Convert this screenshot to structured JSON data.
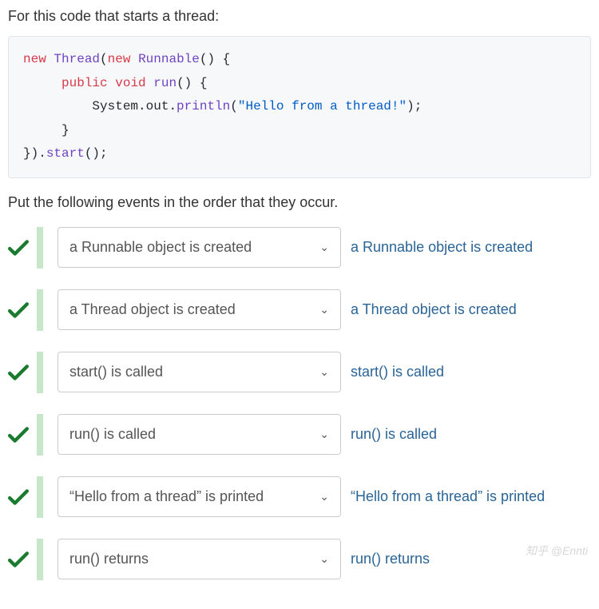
{
  "intro": "For this code that starts a thread:",
  "code": {
    "line1_new": "new",
    "line1_thread": "Thread",
    "line1_open": "(",
    "line1_new2": "new",
    "line1_runnable": "Runnable",
    "line1_tail": "() {",
    "line2_public": "public",
    "line2_void": "void",
    "line2_run": "run",
    "line2_tail": "() {",
    "line3_head": "System.out.",
    "line3_println": "println",
    "line3_open": "(",
    "line3_str": "\"Hello from a thread!\"",
    "line3_close": ");",
    "line4": "}",
    "line5_head": "}).",
    "line5_start": "start",
    "line5_tail": "();"
  },
  "instruction": "Put the following events in the order that they occur.",
  "rows": [
    {
      "selected": "a Runnable object is created",
      "label": "a Runnable object is created"
    },
    {
      "selected": "a Thread object is created",
      "label": "a Thread object is created"
    },
    {
      "selected": "start() is called",
      "label": "start() is called"
    },
    {
      "selected": "run() is called",
      "label": "run() is called"
    },
    {
      "selected": "“Hello from a thread” is printed",
      "label": "“Hello from a thread” is printed"
    },
    {
      "selected": "run() returns",
      "label": "run() returns"
    }
  ],
  "watermark": "知乎 @Ennti"
}
